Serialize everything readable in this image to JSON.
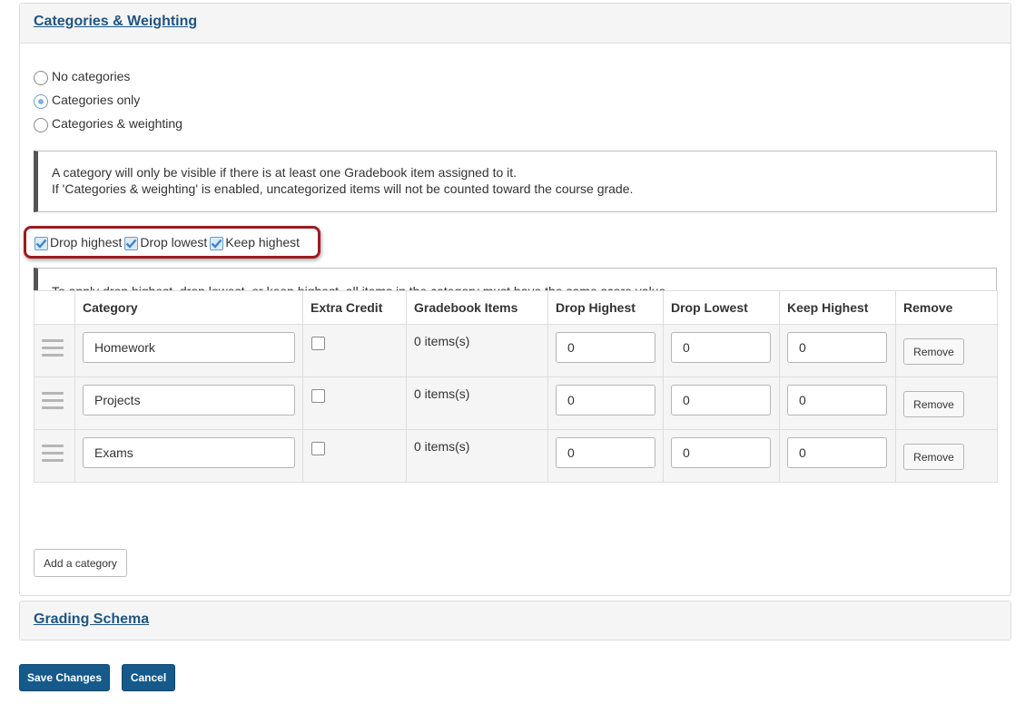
{
  "categories_panel": {
    "title": "Categories & Weighting",
    "options": [
      {
        "label": "No categories",
        "checked": false
      },
      {
        "label": "Categories only",
        "checked": true
      },
      {
        "label": "Categories & weighting",
        "checked": false
      }
    ],
    "info_lines": [
      "A category will only be visible if there is at least one Gradebook item assigned to it.",
      "If 'Categories & weighting' is enabled, uncategorized items will not be counted toward the course grade."
    ],
    "checkboxes": [
      {
        "label": "Drop highest",
        "checked": true
      },
      {
        "label": "Drop lowest",
        "checked": true
      },
      {
        "label": "Keep highest",
        "checked": true
      }
    ],
    "drop_note": "To apply drop highest, drop lowest, or keep highest, all items in the category must have the same score value.",
    "table": {
      "headers": [
        "",
        "Category",
        "Extra Credit",
        "Gradebook Items",
        "Drop Highest",
        "Drop Lowest",
        "Keep Highest",
        "Remove"
      ],
      "rows": [
        {
          "name": "Homework",
          "extra_credit": false,
          "items": "0 items(s)",
          "drop_highest": "0",
          "drop_lowest": "0",
          "keep_highest": "0",
          "remove_label": "Remove"
        },
        {
          "name": "Projects",
          "extra_credit": false,
          "items": "0 items(s)",
          "drop_highest": "0",
          "drop_lowest": "0",
          "keep_highest": "0",
          "remove_label": "Remove"
        },
        {
          "name": "Exams",
          "extra_credit": false,
          "items": "0 items(s)",
          "drop_highest": "0",
          "drop_lowest": "0",
          "keep_highest": "0",
          "remove_label": "Remove"
        }
      ]
    },
    "add_button": "Add a category"
  },
  "grading_panel": {
    "title": "Grading Schema"
  },
  "footer": {
    "save_label": "Save Changes",
    "cancel_label": "Cancel"
  },
  "colors": {
    "primary": "#155a8a",
    "link": "#1f5582",
    "highlight_border": "#9b1c20"
  }
}
